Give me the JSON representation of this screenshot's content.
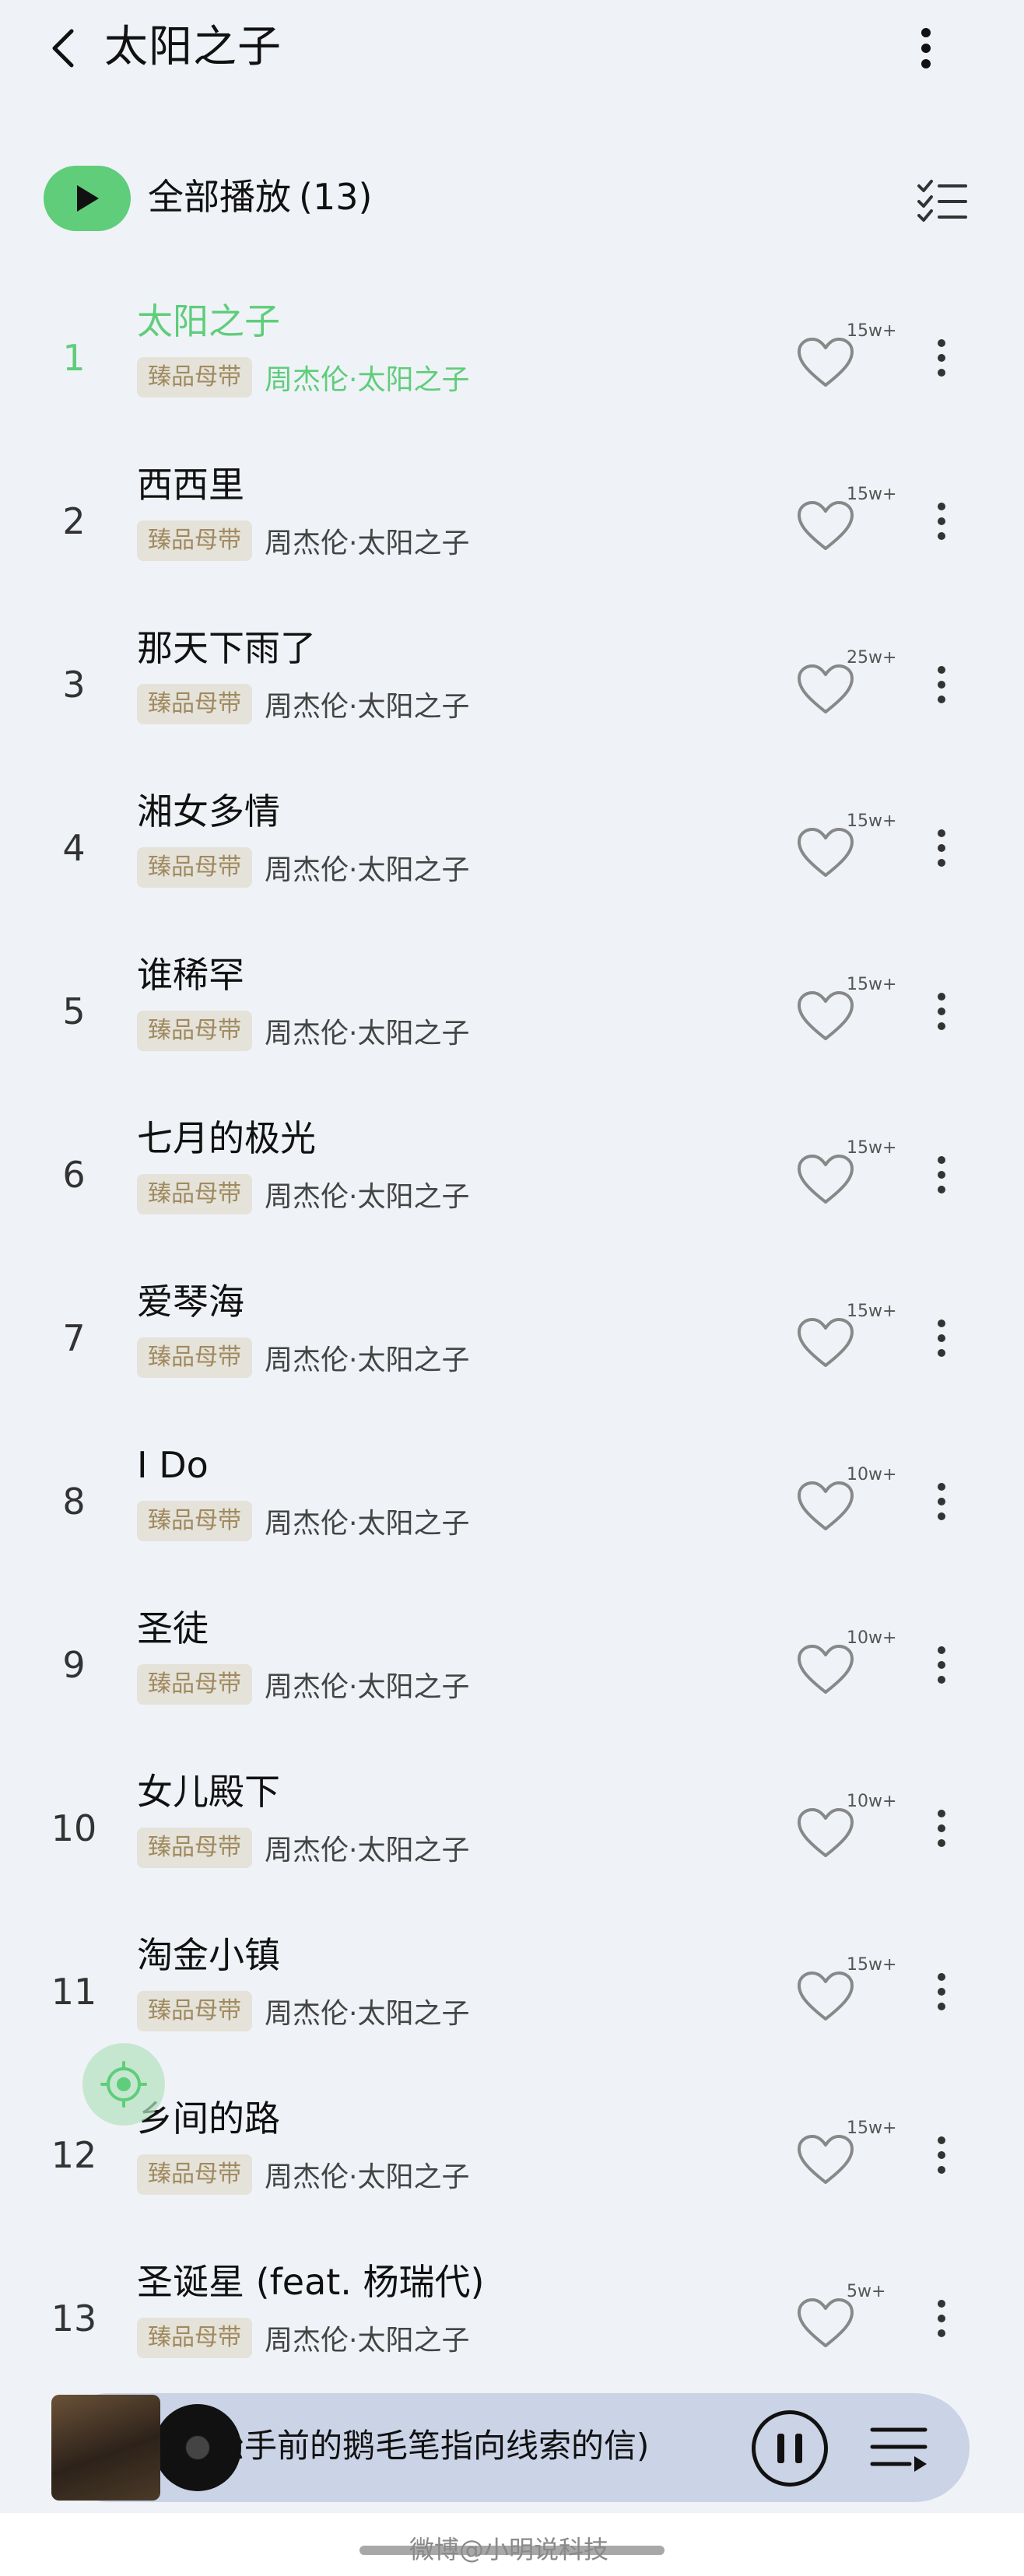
{
  "header": {
    "title": "太阳之子"
  },
  "play_all": {
    "label": "全部播放",
    "count": "(13)"
  },
  "songs": [
    {
      "index": "1",
      "title": "太阳之子",
      "badge": "臻品母带",
      "artist": "周杰伦·太阳之子",
      "likes": "15w+",
      "active": true
    },
    {
      "index": "2",
      "title": "西西里",
      "badge": "臻品母带",
      "artist": "周杰伦·太阳之子",
      "likes": "15w+"
    },
    {
      "index": "3",
      "title": "那天下雨了",
      "badge": "臻品母带",
      "artist": "周杰伦·太阳之子",
      "likes": "25w+"
    },
    {
      "index": "4",
      "title": "湘女多情",
      "badge": "臻品母带",
      "artist": "周杰伦·太阳之子",
      "likes": "15w+"
    },
    {
      "index": "5",
      "title": "谁稀罕",
      "badge": "臻品母带",
      "artist": "周杰伦·太阳之子",
      "likes": "15w+"
    },
    {
      "index": "6",
      "title": "七月的极光",
      "badge": "臻品母带",
      "artist": "周杰伦·太阳之子",
      "likes": "15w+"
    },
    {
      "index": "7",
      "title": "爱琴海",
      "badge": "臻品母带",
      "artist": "周杰伦·太阳之子",
      "likes": "15w+"
    },
    {
      "index": "8",
      "title": "I Do",
      "badge": "臻品母带",
      "artist": "周杰伦·太阳之子",
      "likes": "10w+"
    },
    {
      "index": "9",
      "title": "圣徒",
      "badge": "臻品母带",
      "artist": "周杰伦·太阳之子",
      "likes": "10w+"
    },
    {
      "index": "10",
      "title": "女儿殿下",
      "badge": "臻品母带",
      "artist": "周杰伦·太阳之子",
      "likes": "10w+"
    },
    {
      "index": "11",
      "title": "淘金小镇",
      "badge": "臻品母带",
      "artist": "周杰伦·太阳之子",
      "likes": "15w+"
    },
    {
      "index": "12",
      "title": "乡间的路",
      "badge": "臻品母带",
      "artist": "周杰伦·太阳之子",
      "likes": "15w+"
    },
    {
      "index": "13",
      "title": "圣诞星 (feat. 杨瑞代)",
      "badge": "臻品母带",
      "artist": "周杰伦·太阳之子",
      "likes": "5w+"
    }
  ],
  "player": {
    "now_playing": "松手前的鹅毛笔指向线索的信)"
  },
  "watermark": "微博@小明说科技",
  "colors": {
    "accent": "#5fcd7a",
    "background": "#eff3f7",
    "player_bar": "#cbd3e6",
    "badge_bg": "#e5e2da",
    "badge_text": "#a08a5e"
  },
  "icons": {
    "back": "back-arrow-icon",
    "more": "more-vertical-icon",
    "play": "play-icon",
    "multi_select": "checklist-icon",
    "like": "heart-icon",
    "locate": "locate-icon",
    "pause": "pause-icon",
    "queue": "playlist-queue-icon"
  }
}
